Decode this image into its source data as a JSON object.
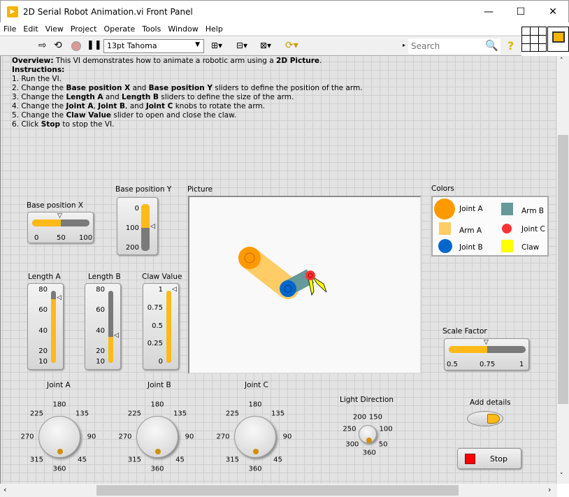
{
  "window": {
    "title": "2D Serial Robot Animation.vi Front Panel",
    "controls": [
      "minimize",
      "maximize",
      "close"
    ]
  },
  "menu": [
    "File",
    "Edit",
    "View",
    "Project",
    "Operate",
    "Tools",
    "Window",
    "Help"
  ],
  "toolbar": {
    "font": "13pt Tahoma",
    "search_placeholder": "Search"
  },
  "description": {
    "overview_label": "Overview:",
    "overview_text": " This VI demonstrates how to animate a robotic arm using a ",
    "overview_bold": "2D Picture",
    "overview_end": ".",
    "instructions_label": "Instructions:",
    "lines": [
      [
        {
          "t": "1. Run the VI."
        }
      ],
      [
        {
          "t": "2. Change the "
        },
        {
          "b": "Base position X"
        },
        {
          "t": " and "
        },
        {
          "b": "Base position Y"
        },
        {
          "t": " sliders to define the position of the arm."
        }
      ],
      [
        {
          "t": "3. Change the "
        },
        {
          "b": "Length A"
        },
        {
          "t": " and "
        },
        {
          "b": "Length B"
        },
        {
          "t": " sliders to define the size of the arm."
        }
      ],
      [
        {
          "t": "4. Change the "
        },
        {
          "b": "Joint A"
        },
        {
          "t": ", "
        },
        {
          "b": "Joint B"
        },
        {
          "t": ", and "
        },
        {
          "b": "Joint C"
        },
        {
          "t": " knobs to rotate the arm."
        }
      ],
      [
        {
          "t": "5. Change the "
        },
        {
          "b": "Claw Value"
        },
        {
          "t": " slider to open and close the claw."
        }
      ],
      [
        {
          "t": "6. Click "
        },
        {
          "b": "Stop"
        },
        {
          "t": " to stop the VI."
        }
      ]
    ]
  },
  "controls": {
    "base_x": {
      "label": "Base position X",
      "value": 50,
      "min": 0,
      "max": 100,
      "ticks": [
        "0",
        "50",
        "100"
      ]
    },
    "base_y": {
      "label": "Base position Y",
      "value": 100,
      "min": 0,
      "max": 200,
      "ticks": [
        "0",
        "100",
        "200"
      ]
    },
    "length_a": {
      "label": "Length A",
      "value": 72,
      "min": 10,
      "max": 80,
      "ticks": [
        "80",
        "60",
        "40",
        "20",
        "10"
      ]
    },
    "length_b": {
      "label": "Length B",
      "value": 35,
      "min": 10,
      "max": 80,
      "ticks": [
        "80",
        "60",
        "40",
        "20",
        "10"
      ]
    },
    "claw": {
      "label": "Claw Value",
      "value": 1,
      "min": 0,
      "max": 1,
      "ticks": [
        "1",
        "0.75",
        "0.5",
        "0.25",
        "0"
      ]
    },
    "scale": {
      "label": "Scale Factor",
      "value": 0.75,
      "min": 0.5,
      "max": 1,
      "ticks": [
        "0.5",
        "0.75",
        "1"
      ]
    },
    "picture_label": "Picture",
    "joint_a": {
      "label": "Joint A",
      "value": 360,
      "ticks": [
        "180",
        "135",
        "90",
        "45",
        "360",
        "315",
        "270",
        "225"
      ]
    },
    "joint_b": {
      "label": "Joint B",
      "value": 360,
      "ticks": [
        "180",
        "135",
        "90",
        "45",
        "360",
        "315",
        "270",
        "225"
      ]
    },
    "joint_c": {
      "label": "Joint C",
      "value": 360,
      "ticks": [
        "180",
        "135",
        "90",
        "45",
        "360",
        "315",
        "270",
        "225"
      ]
    },
    "light": {
      "label": "Light Direction",
      "value": 360,
      "ticks": [
        "200",
        "150",
        "100",
        "50",
        "360",
        "300",
        "250"
      ]
    },
    "add_details": {
      "label": "Add details",
      "value": true
    },
    "stop": {
      "label": "Stop"
    }
  },
  "colors": {
    "label": "Colors",
    "items": [
      {
        "name": "Joint A",
        "color": "#ff9900"
      },
      {
        "name": "Arm B",
        "color": "#669999"
      },
      {
        "name": "Arm A",
        "color": "#ffcc66"
      },
      {
        "name": "Joint C",
        "color": "#ff3333"
      },
      {
        "name": "Joint B",
        "color": "#0066cc"
      },
      {
        "name": "Claw",
        "color": "#ffff00"
      }
    ]
  }
}
